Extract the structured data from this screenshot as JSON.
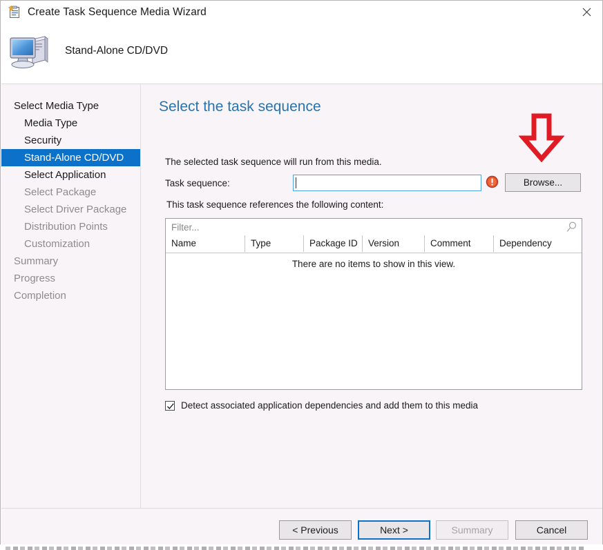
{
  "window": {
    "title": "Create Task Sequence Media Wizard",
    "title_icon": "task-sequence-icon",
    "close_icon": "close-icon",
    "header_icon": "computer-icon",
    "header_subtitle": "Stand-Alone CD/DVD"
  },
  "sidebar": {
    "items": [
      {
        "label": "Select Media Type",
        "level": "parent",
        "state": "normal"
      },
      {
        "label": "Media Type",
        "level": "child",
        "state": "normal"
      },
      {
        "label": "Security",
        "level": "child",
        "state": "normal"
      },
      {
        "label": "Stand-Alone CD/DVD",
        "level": "child",
        "state": "selected"
      },
      {
        "label": "Select Application",
        "level": "child",
        "state": "normal"
      },
      {
        "label": "Select Package",
        "level": "child",
        "state": "dim"
      },
      {
        "label": "Select Driver Package",
        "level": "child",
        "state": "dim"
      },
      {
        "label": "Distribution Points",
        "level": "child",
        "state": "dim"
      },
      {
        "label": "Customization",
        "level": "child",
        "state": "dim"
      },
      {
        "label": "Summary",
        "level": "parent",
        "state": "dim"
      },
      {
        "label": "Progress",
        "level": "parent",
        "state": "dim"
      },
      {
        "label": "Completion",
        "level": "parent",
        "state": "dim"
      }
    ]
  },
  "content": {
    "heading": "Select the task sequence",
    "intro": "The selected task sequence will run from this media.",
    "task_sequence_label": "Task sequence:",
    "task_sequence_value": "",
    "error_icon": "error-exclamation-icon",
    "browse_label": "Browse...",
    "annotation_arrow": "red-down-arrow-icon",
    "references_label": "This task sequence references the following content:",
    "filter_placeholder": "Filter...",
    "filter_value": "",
    "search_icon": "search-icon",
    "table": {
      "columns": [
        "Name",
        "Type",
        "Package ID",
        "Version",
        "Comment",
        "Dependency"
      ],
      "rows": [],
      "empty_message": "There are no items to show in this view."
    },
    "detect_checkbox": {
      "label": "Detect associated application dependencies and add them to this media",
      "checked": true,
      "check_icon": "checkmark-icon"
    }
  },
  "footer": {
    "previous_label": "< Previous",
    "next_label": "Next >",
    "summary_label": "Summary",
    "cancel_label": "Cancel"
  },
  "colors": {
    "accent_blue": "#0b71c9",
    "heading_blue": "#2a72ad",
    "panel_bg": "#f8f4f7",
    "annotation_red": "#e01b24",
    "error_orange": "#e0502a"
  }
}
